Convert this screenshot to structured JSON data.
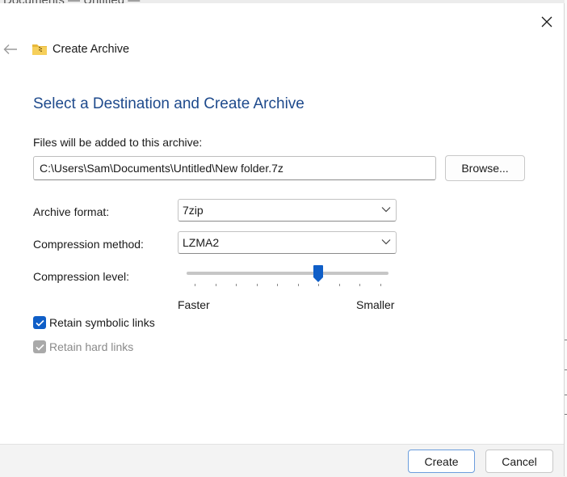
{
  "background": {
    "window_title": "Documents — Untitled — "
  },
  "dialog": {
    "header_title": "Create Archive",
    "heading": "Select a Destination and Create Archive",
    "files_label": "Files will be added to this archive:",
    "archive_path": "C:\\Users\\Sam\\Documents\\Untitled\\New folder.7z",
    "browse_label": "Browse...",
    "archive_format": {
      "label": "Archive format:",
      "selected": "7zip"
    },
    "compression_method": {
      "label": "Compression method:",
      "selected": "LZMA2"
    },
    "compression_level": {
      "label": "Compression level:",
      "min_label": "Faster",
      "max_label": "Smaller",
      "value": 6,
      "max": 9
    },
    "retain_symbolic_links": {
      "label": "Retain symbolic links",
      "checked": true,
      "enabled": true
    },
    "retain_hard_links": {
      "label": "Retain hard links",
      "checked": true,
      "enabled": false
    },
    "create_label": "Create",
    "cancel_label": "Cancel"
  },
  "icons": {
    "close": "close-icon",
    "back": "back-arrow-icon",
    "header": "zip-folder-icon",
    "dropdown": "chevron-down-icon",
    "check": "checkmark-icon"
  },
  "colors": {
    "heading": "#1e4a8c",
    "accent": "#0f5ec7",
    "disabled": "#a9a9a9"
  }
}
